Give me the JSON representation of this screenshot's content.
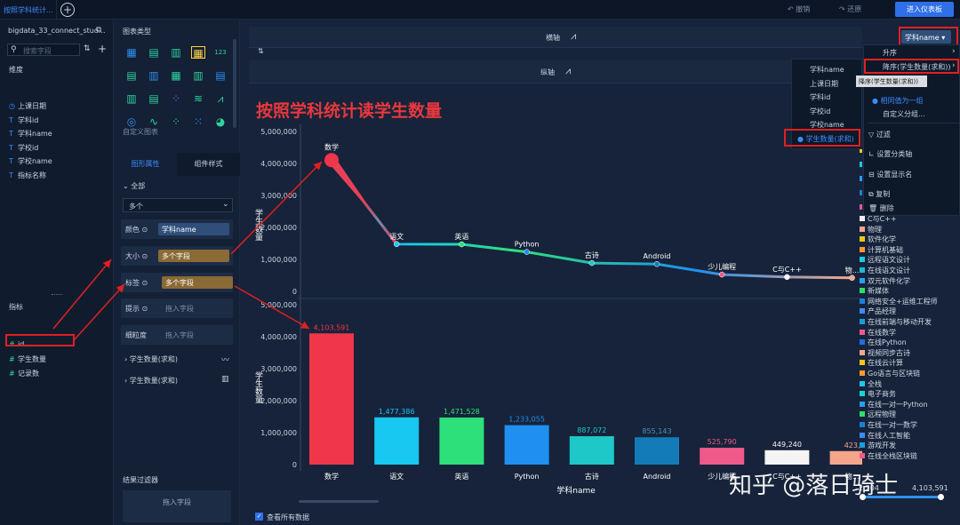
{
  "top": {
    "tab_title": "按照学科统计...",
    "undo": "撤销",
    "redo": "还原",
    "enter_dashboard": "进入仪表板"
  },
  "left": {
    "dataset": "bigdata_33_connect_stud...",
    "search_placeholder": "搜索字段",
    "dim_title": "维度",
    "dims": [
      {
        "icon": "◷",
        "label": "上课日期"
      },
      {
        "icon": "T",
        "label": "学科id"
      },
      {
        "icon": "T",
        "label": "学科name"
      },
      {
        "icon": "T",
        "label": "学校id"
      },
      {
        "icon": "T",
        "label": "学校name"
      },
      {
        "icon": "T",
        "label": "指标名称"
      }
    ],
    "measure_title": "指标",
    "measures": [
      {
        "icon": "#",
        "label": "id"
      },
      {
        "icon": "#",
        "label": "学生数量"
      },
      {
        "icon": "#",
        "label": "记录数"
      }
    ]
  },
  "mid": {
    "chart_type": "图表类型",
    "custom_chart": "自定义图表",
    "tab_shape": "图形属性",
    "tab_style": "组件样式",
    "all": "全部",
    "multi": "多个",
    "color": "颜色",
    "color_val": "学科name",
    "size": "大小",
    "size_val": "多个字段",
    "label": "标签",
    "label_val": "多个字段",
    "tip": "提示",
    "tip_val": "拖入字段",
    "gran": "细粒度",
    "gran_val": "拖入字段",
    "sub1": "学生数量(求和)",
    "sub2": "学生数量(求和)",
    "filter": "结果过滤器",
    "filter_drop": "拖入字段"
  },
  "canvas": {
    "x_axis": "横轴",
    "y_axis": "纵轴",
    "title": "按照学科统计读学生数量",
    "x_field": "学科name",
    "view_all": "查看所有数据",
    "ylabel": "学生数量",
    "xlabel": "学科name",
    "range_min": "2,204",
    "range_max": "4,103,591"
  },
  "sort_menu": {
    "asc": "升序",
    "desc": "降序(学生数量(求和))",
    "tooltip": "降序(学生数量(求和))",
    "same_group": "相同值为一组",
    "custom_group": "自定义分组...",
    "filter": "过滤",
    "set_cat": "设置分类轴",
    "set_name": "设置显示名",
    "copy": "复制",
    "delete": "删除"
  },
  "sub_menu": [
    "学科name",
    "上课日期",
    "学科id",
    "学校id",
    "学校name",
    "学生数量(求和)"
  ],
  "legend": [
    {
      "name": "C与C++",
      "color": "#eeeeee"
    },
    {
      "name": "物理",
      "color": "#f4a58a"
    },
    {
      "name": "软件化学",
      "color": "#f5c518"
    },
    {
      "name": "计算机基础",
      "color": "#ff9933"
    },
    {
      "name": "远程语文设计",
      "color": "#1ec8e8"
    },
    {
      "name": "在线语文设计",
      "color": "#19b9d4"
    },
    {
      "name": "双元软件化学",
      "color": "#2a9df4"
    },
    {
      "name": "新媒体",
      "color": "#2dde6a"
    },
    {
      "name": "网络安全+运维工程师",
      "color": "#1e7fd8"
    },
    {
      "name": "产品经理",
      "color": "#3d8bff"
    },
    {
      "name": "在线前端与移动开发",
      "color": "#1a9ed8"
    },
    {
      "name": "在线数学",
      "color": "#ee5a8a"
    },
    {
      "name": "在线Python",
      "color": "#1f6fe0"
    },
    {
      "name": "视频同步古诗",
      "color": "#f4a58a"
    },
    {
      "name": "在线云计算",
      "color": "#f5c518"
    },
    {
      "name": "Go语言与区块链",
      "color": "#ff9933"
    },
    {
      "name": "全栈",
      "color": "#1ec8e8"
    },
    {
      "name": "电子商务",
      "color": "#19d4d4"
    },
    {
      "name": "在线一对一Python",
      "color": "#2a9df4"
    },
    {
      "name": "远程物理",
      "color": "#2dde6a"
    },
    {
      "name": "在线一对一数学",
      "color": "#1e7fd8"
    },
    {
      "name": "在线人工智能",
      "color": "#3d8bff"
    },
    {
      "name": "游戏开发",
      "color": "#1a9ed8"
    },
    {
      "name": "在线全栈区块链",
      "color": "#ee5a8a"
    }
  ],
  "watermark": "知乎 @落日骑士",
  "chart_data": {
    "type": "line",
    "categories": [
      "数学",
      "语文",
      "英语",
      "Python",
      "古诗",
      "Android",
      "少儿编程",
      "C与C++",
      "物..."
    ],
    "values": [
      4103591,
      1477386,
      1471528,
      1233055,
      887072,
      855143,
      525790,
      449240,
      423000
    ],
    "bar_labels": [
      "4,103,591",
      "1,477,386",
      "1,471,528",
      "1,233,055",
      "887,072",
      "855,143",
      "525,790",
      "449,240",
      "423,"
    ],
    "bar_colors": [
      "#f0364a",
      "#19c8f0",
      "#2de07a",
      "#1f8ff0",
      "#1ec8c8",
      "#137cb8",
      "#ef5a8a",
      "#f4f4f4",
      "#f4a58a"
    ],
    "ylim": [
      0,
      5000000
    ],
    "yticks": [
      "5,000,000",
      "4,000,000",
      "3,000,000",
      "2,000,000",
      "1,000,000",
      "0"
    ],
    "ylabel": "学生数量",
    "xlabel": "学科name"
  }
}
